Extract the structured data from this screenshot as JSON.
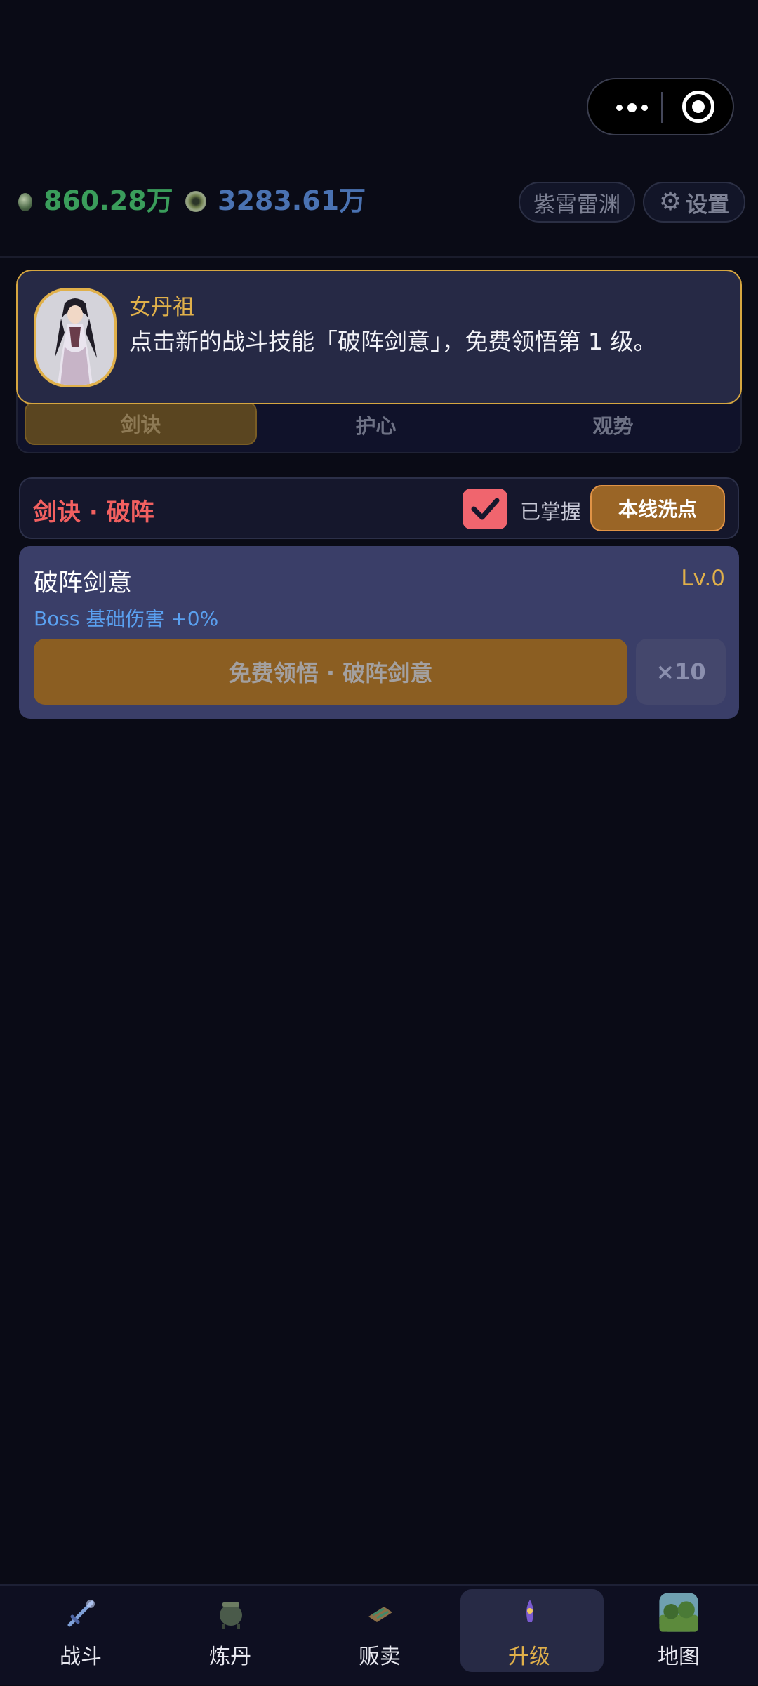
{
  "header": {
    "currencies": [
      {
        "icon": "green-gem-icon",
        "value": "860.28万",
        "color": "#3a9d5b"
      },
      {
        "icon": "spirit-orb-icon",
        "value": "3283.61万",
        "color": "#4a72b2"
      }
    ],
    "realm_label": "紫霄雷渊",
    "settings_label": "设置"
  },
  "dialog": {
    "speaker": "女丹祖",
    "text": "点击新的战斗技能「破阵剑意」，免费领悟第 1 级。"
  },
  "tabs": [
    {
      "label": "剑诀",
      "active": true
    },
    {
      "label": "护心",
      "active": false
    },
    {
      "label": "观势",
      "active": false
    }
  ],
  "section": {
    "title": "剑诀 · 破阵",
    "mastered_label": "已掌握",
    "mastered_checked": true,
    "reset_label": "本线洗点"
  },
  "skill": {
    "name": "破阵剑意",
    "level": "Lv.0",
    "description": "Boss 基础伤害 +0%",
    "learn_label": "免费领悟 · 破阵剑意",
    "multi_label": "×10"
  },
  "nav": [
    {
      "label": "战斗",
      "icon": "sword-icon",
      "active": false
    },
    {
      "label": "炼丹",
      "icon": "cauldron-icon",
      "active": false
    },
    {
      "label": "贩卖",
      "icon": "scroll-icon",
      "active": false
    },
    {
      "label": "升级",
      "icon": "upgrade-icon",
      "active": true
    },
    {
      "label": "地图",
      "icon": "map-icon",
      "active": false
    }
  ],
  "colors": {
    "background": "#0a0b16",
    "gold_accent": "#e0b04a",
    "red_accent": "#f26060",
    "card": "#3a3e68"
  }
}
